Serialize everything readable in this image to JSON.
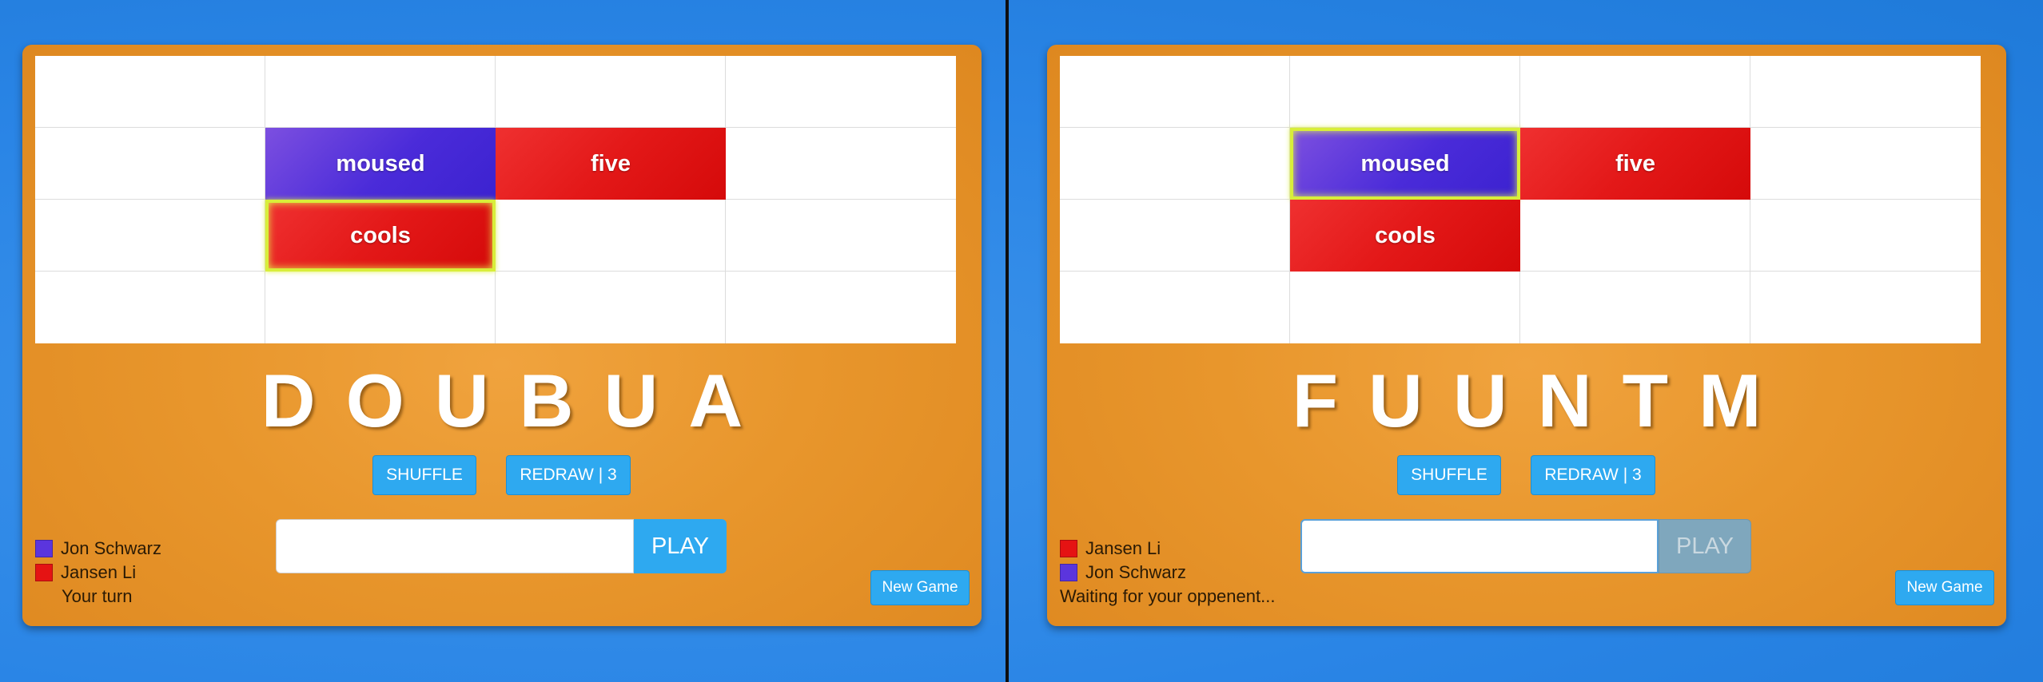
{
  "colors": {
    "purple": "#4a2bd9",
    "red": "#e31818",
    "accent": "#2ea9f0",
    "board": "#e8962c",
    "background": "#2a85e6"
  },
  "left": {
    "tiles": [
      {
        "word": "moused",
        "color": "purple",
        "selected": false
      },
      {
        "word": "five",
        "color": "red",
        "selected": false
      },
      {
        "word": "cools",
        "color": "red",
        "selected": true
      }
    ],
    "rack": "DOUBUA",
    "shuffle_label": "SHUFFLE",
    "redraw_label": "REDRAW | 3",
    "input_value": "",
    "play_label": "PLAY",
    "new_game_label": "New Game",
    "players": [
      {
        "name": "Jon Schwarz",
        "color": "purple"
      },
      {
        "name": "Jansen Li",
        "color": "red"
      }
    ],
    "status": "Your turn"
  },
  "right": {
    "tiles": [
      {
        "word": "moused",
        "color": "purple",
        "selected": true
      },
      {
        "word": "five",
        "color": "red",
        "selected": false
      },
      {
        "word": "cools",
        "color": "red",
        "selected": false
      }
    ],
    "rack": "FUUNTM",
    "shuffle_label": "SHUFFLE",
    "redraw_label": "REDRAW | 3",
    "input_value": "",
    "play_label": "PLAY",
    "play_disabled": true,
    "new_game_label": "New Game",
    "players": [
      {
        "name": "Jansen Li",
        "color": "red"
      },
      {
        "name": "Jon Schwarz",
        "color": "purple"
      }
    ],
    "status": "Waiting for your oppenent..."
  }
}
